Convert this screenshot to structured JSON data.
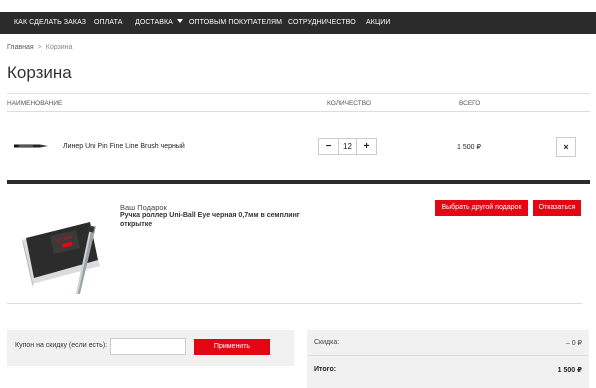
{
  "nav": {
    "items": [
      "КАК СДЕЛАТЬ ЗАКАЗ",
      "ОПЛАТА",
      "ДОСТАВКА",
      "ОПТОВЫМ ПОКУПАТЕЛЯМ",
      "СОТРУДНИЧЕСТВО",
      "АКЦИИ"
    ]
  },
  "breadcrumb": {
    "home": "Главная",
    "separator": ">",
    "current": "Корзина"
  },
  "page": {
    "title": "Корзина"
  },
  "cart": {
    "columns": {
      "name": "НАИМЕНОВАНИЕ",
      "quantity": "КОЛИЧЕСТВО",
      "total": "ВСЕГО"
    },
    "items": [
      {
        "name": "Линер Uni Pin Fine Line Brush черный",
        "quantity": "12",
        "total": "1 500 ₽",
        "decrement": "−",
        "increment": "+",
        "remove": "×"
      }
    ]
  },
  "gift": {
    "label": "Ваш Подарок",
    "name": "Ручка роллер Uni-Ball Eye черная 0,7мм в семплинг открытке",
    "choose_other": "Выбрать другой подарок",
    "decline": "Отказаться"
  },
  "coupon": {
    "label": "Купон на скидку (если есть):",
    "value": "",
    "apply": "Применить"
  },
  "summary": {
    "discount_label": "Скидка:",
    "discount_value": "– 0 ₽",
    "total_label": "Итого:",
    "total_value": "1 500 ₽"
  },
  "colors": {
    "nav_bg": "#2b2b2b",
    "accent": "#e30613",
    "panel_bg": "#f1f1f1"
  }
}
